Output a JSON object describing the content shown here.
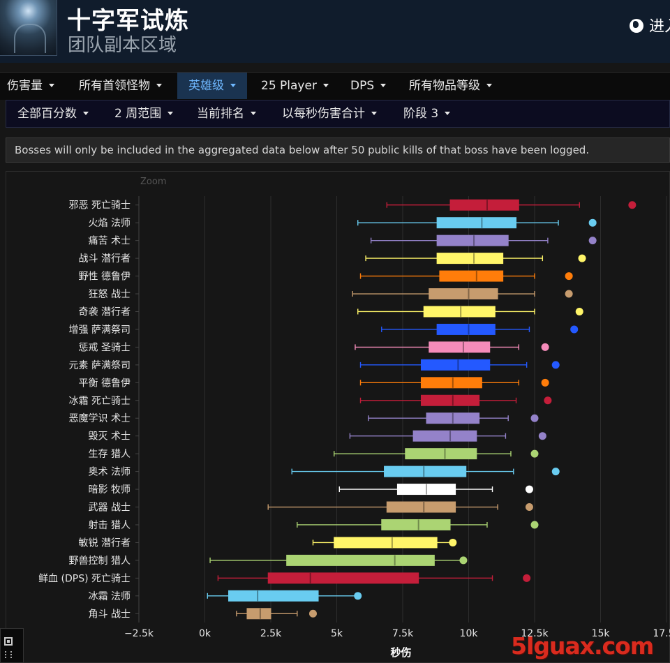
{
  "header": {
    "title": "十字军试炼",
    "subtitle": "团队副本区域",
    "lang_label": "进入"
  },
  "filters_row1": [
    {
      "label": "伤害量",
      "active": false
    },
    {
      "label": "所有首领怪物",
      "active": false
    },
    {
      "label": "英雄级",
      "active": true
    },
    {
      "label": "25 Player",
      "active": false
    },
    {
      "label": "DPS",
      "active": false
    },
    {
      "label": "所有物品等级",
      "active": false
    }
  ],
  "filters_row2": [
    {
      "label": "全部百分数"
    },
    {
      "label": "2 周范围"
    },
    {
      "label": "当前排名"
    },
    {
      "label": "以每秒伤害合计"
    },
    {
      "label": "阶段 3"
    }
  ],
  "notice": "Bosses will only be included in the aggregated data below after 50 public kills of that boss have been logged.",
  "zoom_label": "Zoom",
  "watermark": "5lguax.com",
  "chart_data": {
    "type": "boxplot",
    "orientation": "horizontal",
    "xlabel": "秒伤",
    "xlim": [
      -2500,
      17500
    ],
    "xticks": [
      -2500,
      0,
      2500,
      5000,
      7500,
      10000,
      12500,
      15000,
      17500
    ],
    "xtick_labels": [
      "−2.5k",
      "0k",
      "2.5k",
      "5k",
      "7.5k",
      "10k",
      "12.5k",
      "15k",
      "17.5k"
    ],
    "grid": true,
    "series": [
      {
        "label": "邪恶 死亡骑士",
        "color": "#c41e3a",
        "min": 6900,
        "q1": 9300,
        "median": 10700,
        "q3": 11900,
        "max": 14200,
        "outlier": 16200
      },
      {
        "label": "火焰 法师",
        "color": "#69ccf0",
        "min": 5800,
        "q1": 8800,
        "median": 10500,
        "q3": 11800,
        "max": 13400,
        "outlier": 14700
      },
      {
        "label": "痛苦 术士",
        "color": "#9482c9",
        "min": 6300,
        "q1": 8800,
        "median": 10200,
        "q3": 11500,
        "max": 13000,
        "outlier": 14700
      },
      {
        "label": "战斗 潜行者",
        "color": "#fff569",
        "min": 6100,
        "q1": 8800,
        "median": 10200,
        "q3": 11300,
        "max": 12800,
        "outlier": 14300
      },
      {
        "label": "野性 德鲁伊",
        "color": "#ff7d0a",
        "min": 5900,
        "q1": 8900,
        "median": 10300,
        "q3": 11300,
        "max": 12500,
        "outlier": 13800
      },
      {
        "label": "狂怒 战士",
        "color": "#c79c6e",
        "min": 5600,
        "q1": 8500,
        "median": 10000,
        "q3": 11100,
        "max": 12500,
        "outlier": 13800
      },
      {
        "label": "奇袭 潜行者",
        "color": "#fff569",
        "min": 5800,
        "q1": 8300,
        "median": 9700,
        "q3": 11000,
        "max": 12500,
        "outlier": 14200
      },
      {
        "label": "增强 萨满祭司",
        "color": "#2459ff",
        "min": 6700,
        "q1": 8800,
        "median": 10000,
        "q3": 11000,
        "max": 12300,
        "outlier": 14000
      },
      {
        "label": "惩戒 圣骑士",
        "color": "#f58cba",
        "min": 5700,
        "q1": 8500,
        "median": 9800,
        "q3": 10800,
        "max": 11900,
        "outlier": 12900
      },
      {
        "label": "元素 萨满祭司",
        "color": "#2459ff",
        "min": 5900,
        "q1": 8200,
        "median": 9600,
        "q3": 10800,
        "max": 12200,
        "outlier": 13300
      },
      {
        "label": "平衡 德鲁伊",
        "color": "#ff7d0a",
        "min": 5900,
        "q1": 8200,
        "median": 9400,
        "q3": 10500,
        "max": 11900,
        "outlier": 12900
      },
      {
        "label": "冰霜 死亡骑士",
        "color": "#c41e3a",
        "min": 5900,
        "q1": 8200,
        "median": 9400,
        "q3": 10400,
        "max": 11800,
        "outlier": 13000
      },
      {
        "label": "恶魔学识 术士",
        "color": "#9482c9",
        "min": 6200,
        "q1": 8400,
        "median": 9400,
        "q3": 10400,
        "max": 11500,
        "outlier": 12500
      },
      {
        "label": "毁灭 术士",
        "color": "#9482c9",
        "min": 5500,
        "q1": 7900,
        "median": 9300,
        "q3": 10300,
        "max": 11400,
        "outlier": 12800
      },
      {
        "label": "生存 猎人",
        "color": "#abd473",
        "min": 4900,
        "q1": 7600,
        "median": 9100,
        "q3": 10300,
        "max": 11600,
        "outlier": 12500
      },
      {
        "label": "奥术 法师",
        "color": "#69ccf0",
        "min": 3300,
        "q1": 6800,
        "median": 8300,
        "q3": 9900,
        "max": 11700,
        "outlier": 13300
      },
      {
        "label": "暗影 牧师",
        "color": "#ffffff",
        "min": 5100,
        "q1": 7300,
        "median": 8400,
        "q3": 9500,
        "max": 10900,
        "outlier": 12300
      },
      {
        "label": "武器 战士",
        "color": "#c79c6e",
        "min": 2400,
        "q1": 6900,
        "median": 8300,
        "q3": 9500,
        "max": 11100,
        "outlier": 12300
      },
      {
        "label": "射击 猎人",
        "color": "#abd473",
        "min": 3500,
        "q1": 6700,
        "median": 8100,
        "q3": 9300,
        "max": 10700,
        "outlier": 12500
      },
      {
        "label": "敏锐 潜行者",
        "color": "#fff569",
        "min": 4100,
        "q1": 4900,
        "median": 7100,
        "q3": 8800,
        "max": 9400,
        "outlier": 9400
      },
      {
        "label": "野兽控制 猎人",
        "color": "#abd473",
        "min": 200,
        "q1": 3100,
        "median": 7200,
        "q3": 8700,
        "max": 9800,
        "outlier": 9800
      },
      {
        "label": "鲜血 (DPS) 死亡骑士",
        "color": "#c41e3a",
        "min": 500,
        "q1": 2400,
        "median": 4000,
        "q3": 8100,
        "max": 10900,
        "outlier": 12200
      },
      {
        "label": "冰霜 法师",
        "color": "#69ccf0",
        "min": 100,
        "q1": 900,
        "median": 2000,
        "q3": 4300,
        "max": 5800,
        "outlier": 5800
      },
      {
        "label": "角斗 战士",
        "color": "#c79c6e",
        "min": 1200,
        "q1": 1600,
        "median": 2100,
        "q3": 2500,
        "max": 3500,
        "outlier": 4100
      }
    ]
  }
}
